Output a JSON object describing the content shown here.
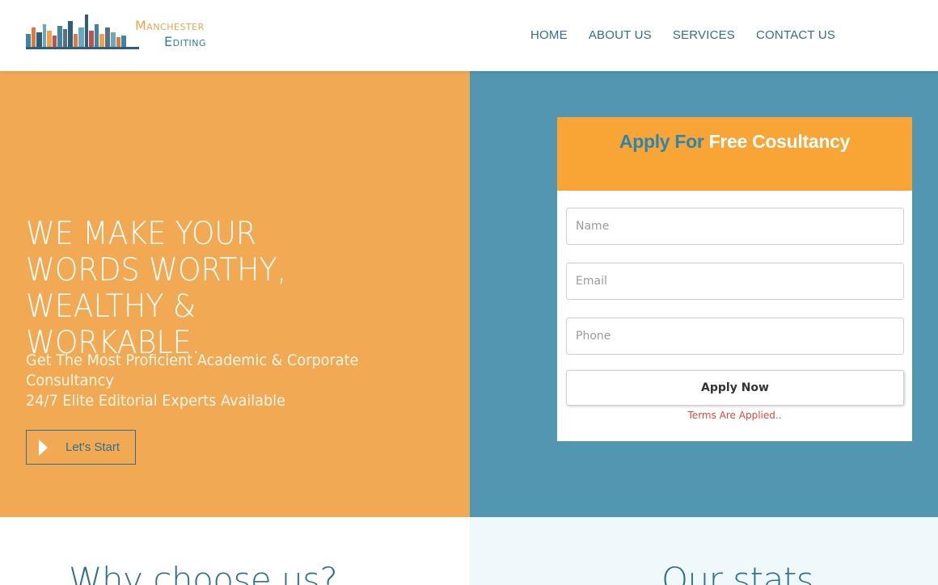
{
  "header": {
    "logo": {
      "line1": "Manchester",
      "line2": "Editing"
    },
    "nav": [
      "HOME",
      "ABOUT US",
      "SERVICES",
      "CONTACT US"
    ]
  },
  "hero": {
    "headline": "WE MAKE YOUR WORDS WORTHY, WEALTHY & WORKABLE.",
    "subline_1": "Get The Most Proficient Academic & Corporate Consultancy",
    "subline_2": "24/7 Elite Editorial Experts Available",
    "cta": "Let's Start"
  },
  "form": {
    "title_accent": "Apply For",
    "title_rest": "Free Cosultancy",
    "name_placeholder": "Name",
    "email_placeholder": "Email",
    "phone_placeholder": "Phone",
    "submit": "Apply Now",
    "terms": "Terms Are Applied.."
  },
  "sections": {
    "why": "Why choose us?",
    "stats": "Our stats"
  },
  "colors": {
    "orange_panel": "#f1aa53",
    "blue_panel": "#5296b1",
    "card_header": "#f9a536",
    "accent_blue": "#2b86ad",
    "terms_red": "#e2463f"
  }
}
